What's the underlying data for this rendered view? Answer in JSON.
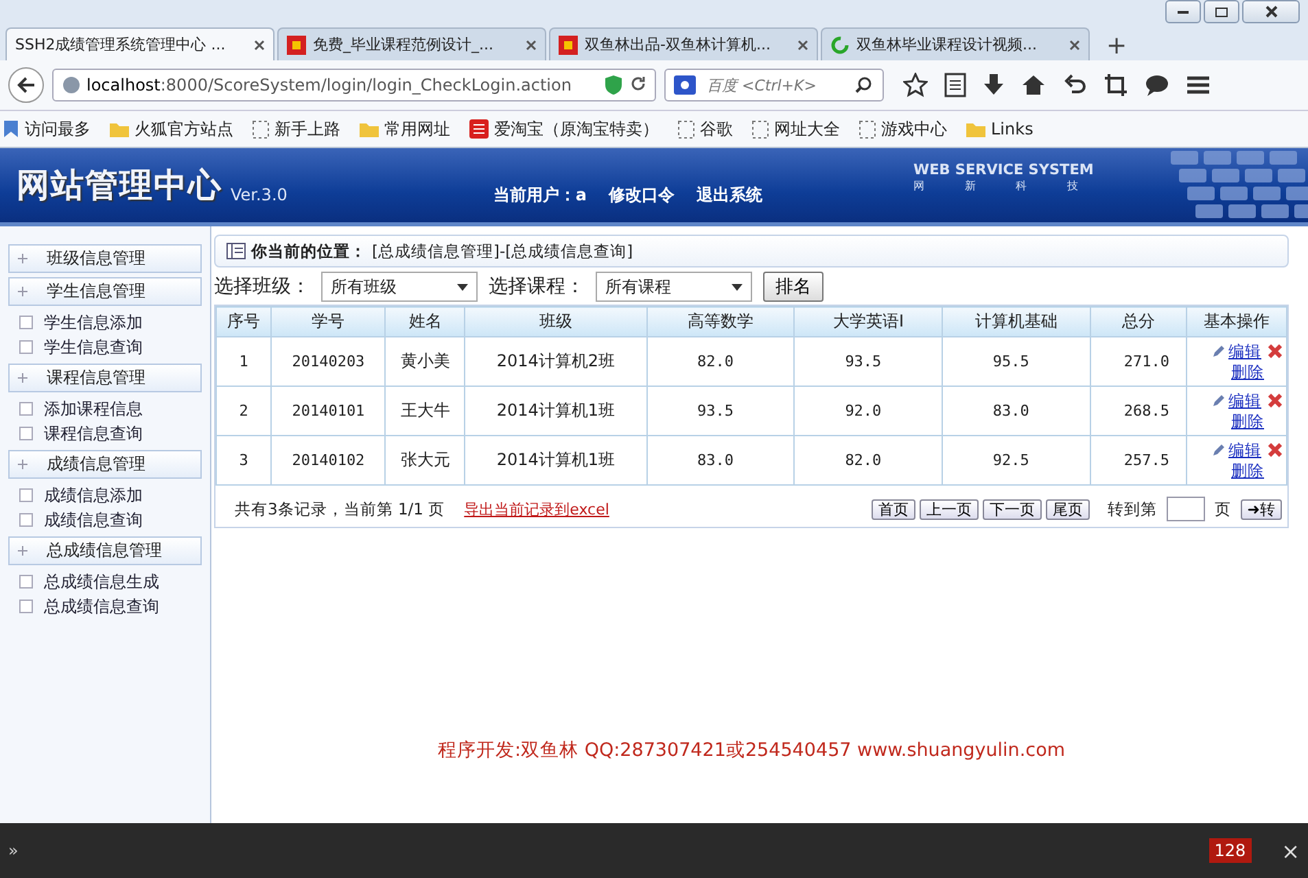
{
  "browser": {
    "tabs": [
      {
        "title": "SSH2成绩管理系统管理中心 ...",
        "selected": true,
        "kind": "plain"
      },
      {
        "title": "免费_毕业课程范例设计_...",
        "selected": false,
        "kind": "site"
      },
      {
        "title": "双鱼林出品-双鱼林计算机...",
        "selected": false,
        "kind": "site"
      },
      {
        "title": "双鱼林毕业课程设计视频...",
        "selected": false,
        "kind": "loading"
      }
    ],
    "new_tab": "+",
    "url_host": "localhost",
    "url_rest": ":8000/ScoreSystem/login/login_CheckLogin.action",
    "search_placeholder": "百度 <Ctrl+K>",
    "bookmarks": [
      {
        "label": "访问最多",
        "kind": "smart"
      },
      {
        "label": "火狐官方站点",
        "kind": "folder"
      },
      {
        "label": "新手上路",
        "kind": "page"
      },
      {
        "label": "常用网址",
        "kind": "folder"
      },
      {
        "label": "爱淘宝（原淘宝特卖）",
        "kind": "site"
      },
      {
        "label": "谷歌",
        "kind": "page"
      },
      {
        "label": "网址大全",
        "kind": "page"
      },
      {
        "label": "游戏中心",
        "kind": "page"
      },
      {
        "label": "Links",
        "kind": "folder"
      }
    ]
  },
  "header": {
    "title": "网站管理中心",
    "version": "Ver.3.0",
    "user_label": "当前用户：a",
    "links": [
      "修改口令",
      "退出系统"
    ],
    "brand": "WEB SERVICE SYSTEM",
    "brand_sub": [
      "网",
      "新",
      "科",
      "技"
    ]
  },
  "sidebar": {
    "groups": [
      {
        "label": "班级信息管理"
      },
      {
        "label": "学生信息管理",
        "children": [
          {
            "label": "学生信息添加"
          },
          {
            "label": "学生信息查询"
          }
        ]
      },
      {
        "label": "课程信息管理",
        "children": [
          {
            "label": "添加课程信息"
          },
          {
            "label": "课程信息查询"
          }
        ]
      },
      {
        "label": "成绩信息管理",
        "children": [
          {
            "label": "成绩信息添加"
          },
          {
            "label": "成绩信息查询"
          }
        ]
      },
      {
        "label": "总成绩信息管理",
        "children": [
          {
            "label": "总成绩信息生成"
          },
          {
            "label": "总成绩信息查询"
          }
        ]
      }
    ]
  },
  "breadcrumb": {
    "label": "你当前的位置：",
    "path": "[总成绩信息管理]-[总成绩信息查询]"
  },
  "filters": [
    {
      "label": "选择班级：",
      "value": "所有班级"
    },
    {
      "label": "选择课程：",
      "value": "所有课程"
    }
  ],
  "rank_button": "排名",
  "table": {
    "columns": [
      "序号",
      "学号",
      "姓名",
      "班级",
      "高等数学",
      "大学英语I",
      "计算机基础",
      "总分",
      "基本操作"
    ],
    "rows": [
      {
        "cells": [
          "1",
          "20140203",
          "黄小美",
          "2014计算机2班",
          "82.0",
          "93.5",
          "95.5",
          "271.0"
        ],
        "edit": "编辑",
        "delete": "删除"
      },
      {
        "cells": [
          "2",
          "20140101",
          "王大牛",
          "2014计算机1班",
          "93.5",
          "92.0",
          "83.0",
          "268.5"
        ],
        "edit": "编辑",
        "delete": "删除"
      },
      {
        "cells": [
          "3",
          "20140102",
          "张大元",
          "2014计算机1班",
          "83.0",
          "82.0",
          "92.5",
          "257.5"
        ],
        "edit": "编辑",
        "delete": "删除"
      }
    ]
  },
  "pager": {
    "summary": "共有3条记录，当前第 1/1 页",
    "export_link": "导出当前记录到excel",
    "buttons": [
      "首页",
      "上一页",
      "下一页",
      "尾页"
    ],
    "goto_label": "转到第",
    "page_unit": "页",
    "go_button": "➜转"
  },
  "footer": "程序开发:双鱼林 QQ:287307421或254540457 www.shuangyulin.com",
  "status_bar": {
    "expander": "»",
    "badge": "128",
    "close": "×"
  }
}
